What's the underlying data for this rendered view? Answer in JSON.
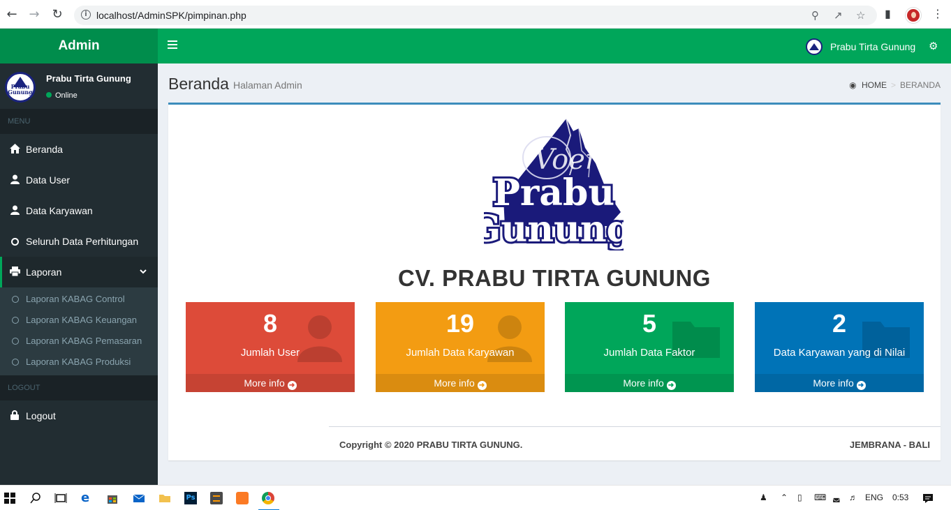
{
  "browser": {
    "url": "localhost/AdminSPK/pimpinan.php"
  },
  "header": {
    "brand": "Admin",
    "user_name": "Prabu Tirta Gunung"
  },
  "sidebar": {
    "user_name": "Prabu Tirta Gunung",
    "status": "Online",
    "menu_header": "MENU",
    "items": [
      {
        "label": "Beranda",
        "icon": "home-icon"
      },
      {
        "label": "Data User",
        "icon": "user-icon"
      },
      {
        "label": "Data Karyawan",
        "icon": "user-icon"
      },
      {
        "label": "Seluruh Data Perhitungan",
        "icon": "circle-icon"
      },
      {
        "label": "Laporan",
        "icon": "print-icon"
      }
    ],
    "submenu": [
      {
        "label": "Laporan KABAG Control"
      },
      {
        "label": "Laporan KABAG Keuangan"
      },
      {
        "label": "Laporan KABAG Pemasaran"
      },
      {
        "label": "Laporan KABAG Produksi"
      }
    ],
    "logout_header": "LOGOUT",
    "logout_label": "Logout"
  },
  "page": {
    "title": "Beranda",
    "subtitle": "Halaman Admin",
    "breadcrumb_home": "HOME",
    "breadcrumb_current": "BERANDA",
    "logo_text_top": "Prabu",
    "logo_text_bottom": "Gunung",
    "logo_script": "Voer",
    "company": "CV. PRABU TIRTA GUNUNG",
    "copyright": "Copyright © 2020 PRABU TIRTA GUNUNG.",
    "location": "JEMBRANA - BALI"
  },
  "stats": [
    {
      "value": "8",
      "label": "Jumlah User",
      "more": "More info",
      "color": "#dd4b39",
      "icon": "user-icon"
    },
    {
      "value": "19",
      "label": "Jumlah Data Karyawan",
      "more": "More info",
      "color": "#f39c12",
      "icon": "user-icon"
    },
    {
      "value": "5",
      "label": "Jumlah Data Faktor",
      "more": "More info",
      "color": "#00a65a",
      "icon": "folder-icon"
    },
    {
      "value": "2",
      "label": "Data Karyawan yang di Nilai",
      "more": "More info",
      "color": "#0073b7",
      "icon": "folder-icon"
    }
  ],
  "taskbar": {
    "lang": "ENG",
    "time": "0:53"
  }
}
